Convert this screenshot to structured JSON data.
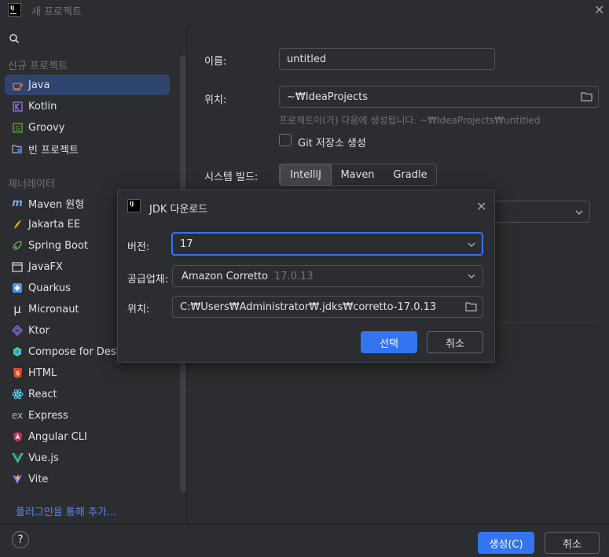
{
  "window": {
    "title": "새 프로젝트",
    "app_icon_text": "IJ"
  },
  "sidebar": {
    "search_placeholder": "",
    "section_new": "신규 프로젝트",
    "new_items": [
      {
        "label": "Java",
        "icon": "java-cup-icon",
        "selected": true
      },
      {
        "label": "Kotlin",
        "icon": "kotlin-icon"
      },
      {
        "label": "Groovy",
        "icon": "groovy-icon"
      },
      {
        "label": "빈 프로젝트",
        "icon": "empty-project-icon"
      }
    ],
    "section_generators": "제너레이터",
    "generator_items": [
      {
        "label": "Maven 원형",
        "icon": "maven-icon"
      },
      {
        "label": "Jakarta EE",
        "icon": "jakarta-icon"
      },
      {
        "label": "Spring Boot",
        "icon": "spring-icon"
      },
      {
        "label": "JavaFX",
        "icon": "javafx-icon"
      },
      {
        "label": "Quarkus",
        "icon": "quarkus-icon"
      },
      {
        "label": "Micronaut",
        "icon": "micronaut-icon"
      },
      {
        "label": "Ktor",
        "icon": "ktor-icon"
      },
      {
        "label": "Compose for Desktop",
        "icon": "compose-icon"
      },
      {
        "label": "HTML",
        "icon": "html5-icon"
      },
      {
        "label": "React",
        "icon": "react-icon"
      },
      {
        "label": "Express",
        "icon": "express-icon"
      },
      {
        "label": "Angular CLI",
        "icon": "angular-icon"
      },
      {
        "label": "Vue.js",
        "icon": "vue-icon"
      },
      {
        "label": "Vite",
        "icon": "vite-icon"
      }
    ],
    "plugin_link": "플러그인을 통해 추가..."
  },
  "form": {
    "name_label": "이름:",
    "name_value": "untitled",
    "location_label": "위치:",
    "location_value": "~₩IdeaProjects",
    "location_hint": "프로젝트이(가) 다음에 생성됩니다. ~₩IdeaProjects₩untitled",
    "git_label": "Git 저장소 생성",
    "build_label": "시스템 빌드:",
    "build_options": [
      "IntelliJ",
      "Maven",
      "Gradle"
    ],
    "build_selected": "IntelliJ"
  },
  "dialog": {
    "title": "JDK 다운로드",
    "version_label": "버전:",
    "version_value": "17",
    "vendor_label": "공급업체:",
    "vendor_value": "Amazon Corretto",
    "vendor_version": "17.0.13",
    "location_label": "위치:",
    "location_value": "C:₩Users₩Administrator₩.jdks₩corretto-17.0.13",
    "select_button": "선택",
    "cancel_button": "취소"
  },
  "footer": {
    "help_label": "?",
    "create_button": "생성(C)",
    "cancel_button": "취소"
  },
  "colors": {
    "accent": "#3574f0",
    "selection": "#2e436e",
    "background": "#2b2d30",
    "link": "#548af7"
  }
}
